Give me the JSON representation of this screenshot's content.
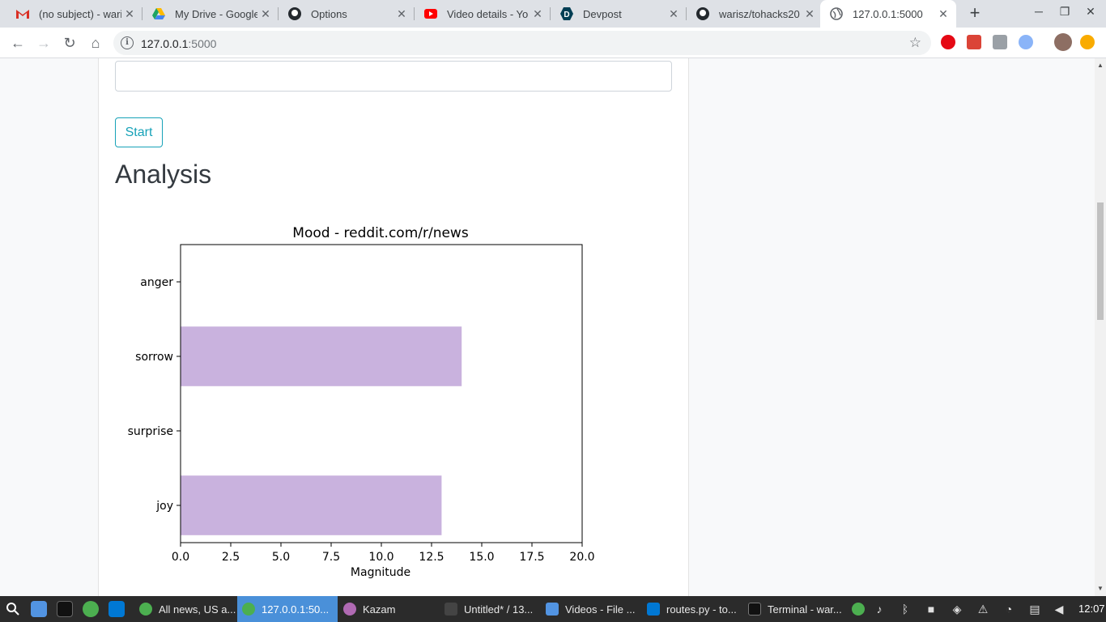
{
  "browser": {
    "tabs": [
      {
        "title": "(no subject) - wari",
        "icon": "gmail-icon",
        "color": "#d93025"
      },
      {
        "title": "My Drive - Google",
        "icon": "google-drive-icon",
        "color": "#1fa463"
      },
      {
        "title": "Options",
        "icon": "github-icon",
        "color": "#24292e"
      },
      {
        "title": "Video details - Yo",
        "icon": "youtube-icon",
        "color": "#ff0000"
      },
      {
        "title": "Devpost",
        "icon": "devpost-icon",
        "color": "#003e54"
      },
      {
        "title": "warisz/tohacks20",
        "icon": "github-icon",
        "color": "#24292e"
      },
      {
        "title": "127.0.0.1:5000",
        "icon": "globe-icon",
        "color": "#5f6368"
      }
    ],
    "url_host": "127.0.0.1",
    "url_port": ":5000"
  },
  "page": {
    "start_label": "Start",
    "heading": "Analysis"
  },
  "chart_data": {
    "type": "bar",
    "orientation": "horizontal",
    "title": "Mood - reddit.com/r/news",
    "xlabel": "Magnitude",
    "ylabel": "",
    "categories": [
      "anger",
      "sorrow",
      "surprise",
      "joy"
    ],
    "values": [
      0,
      14,
      0,
      13
    ],
    "xlim": [
      0,
      20
    ],
    "xticks": [
      "0.0",
      "2.5",
      "5.0",
      "7.5",
      "10.0",
      "12.5",
      "15.0",
      "17.5",
      "20.0"
    ],
    "bar_color": "#c9b2de",
    "grid": false
  },
  "taskbar": {
    "items": [
      {
        "title": "All news, US a...",
        "icon": "chrome-icon"
      },
      {
        "title": "127.0.0.1:50...",
        "icon": "chrome-icon"
      },
      {
        "title": "Kazam",
        "icon": "kazam-icon"
      },
      {
        "title": "Untitled* / 13...",
        "icon": "inkscape-icon"
      },
      {
        "title": "Videos - File ...",
        "icon": "folder-icon"
      },
      {
        "title": "routes.py - to...",
        "icon": "vscode-icon"
      },
      {
        "title": "Terminal - war...",
        "icon": "terminal-icon"
      }
    ],
    "clock": "12:07"
  }
}
